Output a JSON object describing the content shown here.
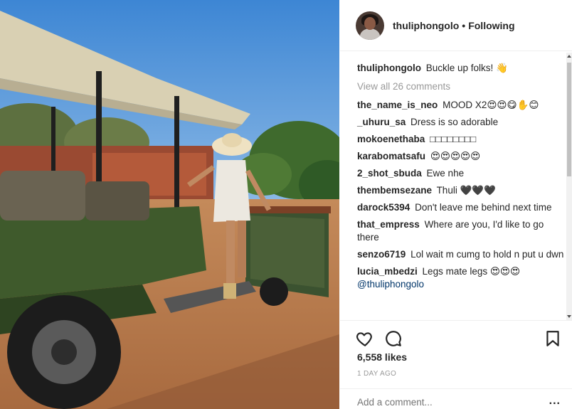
{
  "photo": {
    "icon": "safari-vehicle-photo"
  },
  "header": {
    "username": "thuliphongolo",
    "separator": "•",
    "follow_label": "Following"
  },
  "caption": {
    "username": "thuliphongolo",
    "text": "Buckle up folks! 👋"
  },
  "view_all": "View all 26 comments",
  "comments": [
    {
      "username": "the_name_is_neo",
      "text": "MOOD X2😍😍😋✋😊"
    },
    {
      "username": "_uhuru_sa",
      "text": "Dress is so adorable"
    },
    {
      "username": "mokoenethaba",
      "text": "□□□□□□□□"
    },
    {
      "username": "karabomatsafu",
      "text": "😍😍😍😍😍"
    },
    {
      "username": "2_shot_sbuda",
      "text": "Ewe nhe"
    },
    {
      "username": "thembemsezane",
      "text": "Thuli 🖤🖤🖤"
    },
    {
      "username": "darock5394",
      "text": "Don't leave me behind next time"
    },
    {
      "username": "that_empress",
      "text": "Where are you, I'd like to go there"
    },
    {
      "username": "senzo6719",
      "text": "Lol wait m cumg to hold n put u dwn"
    },
    {
      "username": "lucia_mbedzi",
      "text": "Legs mate legs 😍😍😍",
      "mention": "@thuliphongolo"
    }
  ],
  "actions": {
    "like_icon": "heart-outline-icon",
    "comment_icon": "speech-bubble-icon",
    "save_icon": "bookmark-icon"
  },
  "likes": "6,558 likes",
  "time_ago": "1 DAY AGO",
  "add_comment": {
    "placeholder": "Add a comment...",
    "more": "..."
  },
  "colors": {
    "sky": "#4a8fd6",
    "canvas_roof": "#d8cfb2",
    "vehicle_green": "#3f5a2c",
    "ground": "#b57a4e",
    "mention_blue": "#003569",
    "muted_text": "#999999"
  }
}
